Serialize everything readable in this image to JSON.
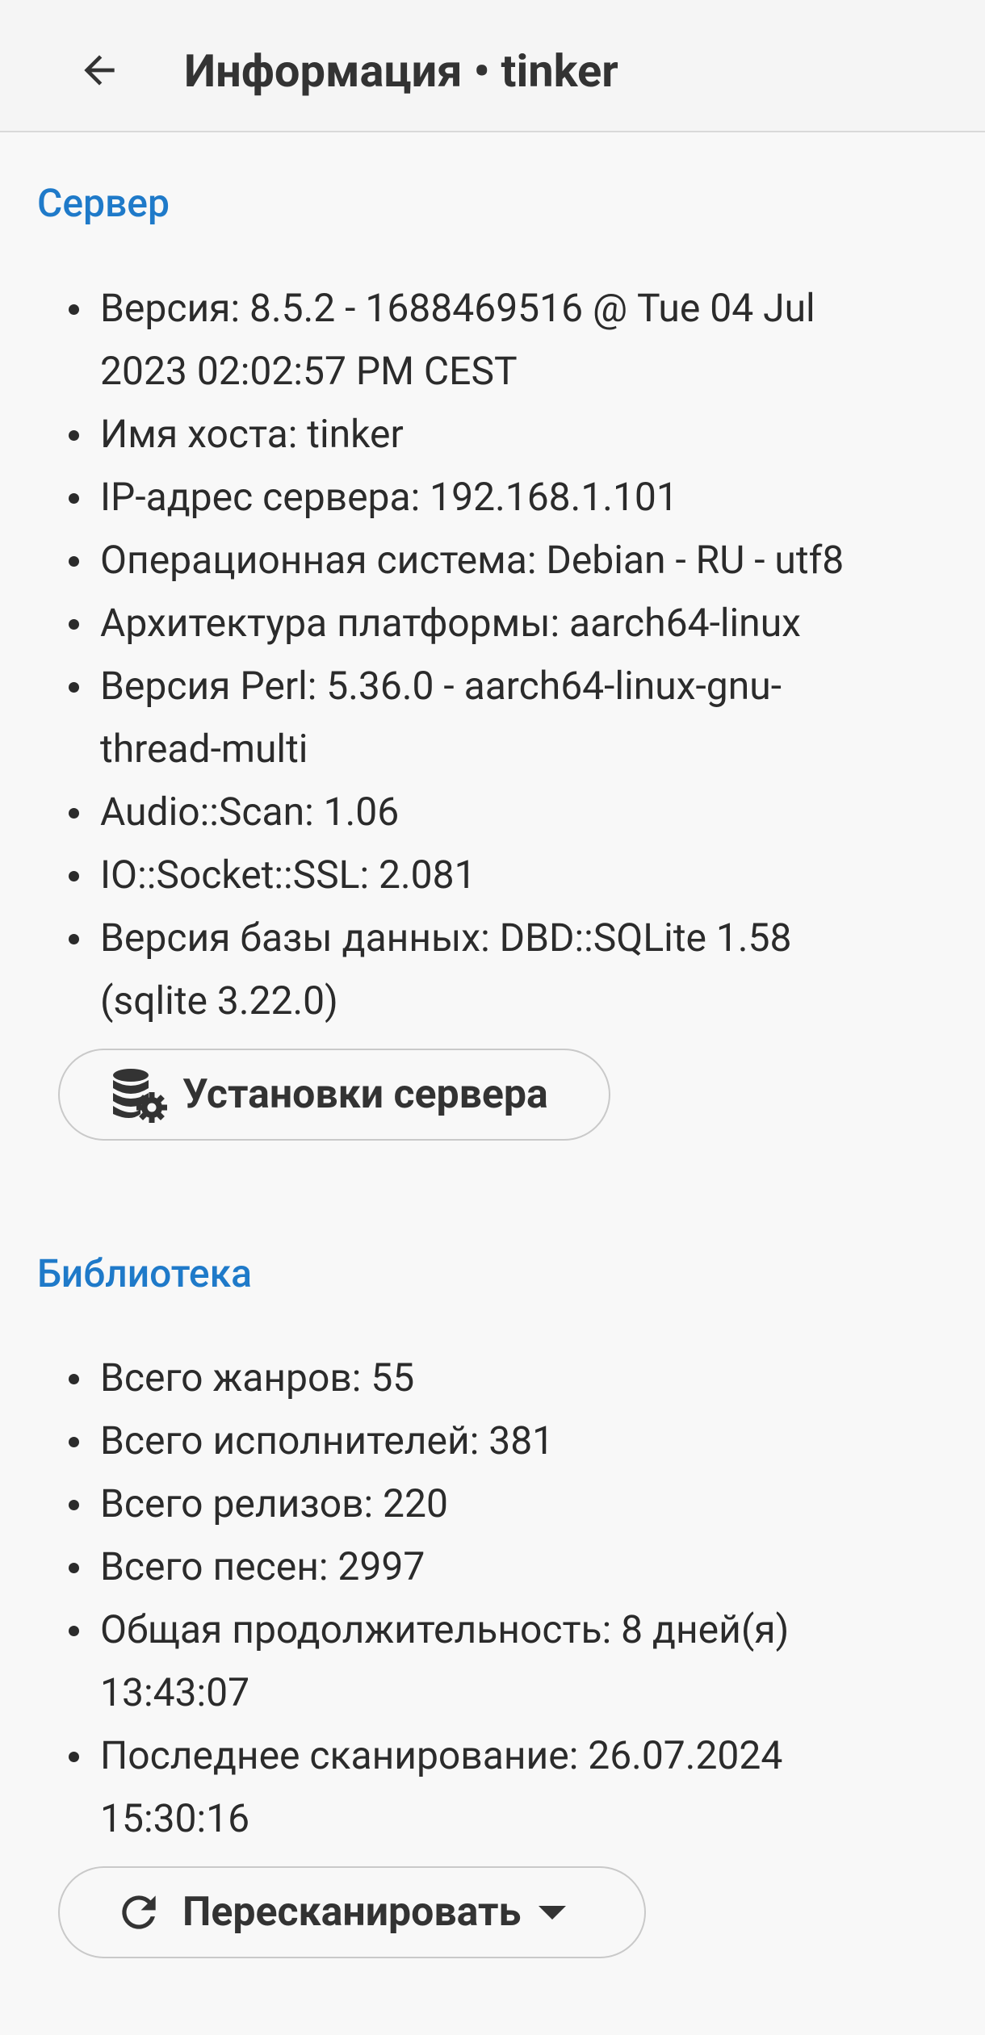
{
  "appbar": {
    "title": "Информация • tinker"
  },
  "server": {
    "section_title": "Сервер",
    "items": [
      "Версия: 8.5.2 - 1688469516 @ Tue 04 Jul 2023 02:02:57 PM CEST",
      "Имя хоста: tinker",
      "IP-адрес сервера: 192.168.1.101",
      "Операционная система: Debian - RU - utf8",
      "Архитектура платформы: aarch64-linux",
      "Версия Perl: 5.36.0 - aarch64-linux-gnu-thread-multi",
      "Audio::Scan: 1.06",
      "IO::Socket::SSL: 2.081",
      "Версия базы данных: DBD::SQLite 1.58 (sqlite 3.22.0)"
    ],
    "settings_button": "Установки сервера",
    "settings_icon": "database-gear-icon"
  },
  "library": {
    "section_title": "Библиотека",
    "items": [
      "Всего жанров: 55",
      "Всего исполнителей: 381",
      "Всего релизов: 220",
      "Всего песен: 2997",
      "Общая продолжительность: 8 дней(я) 13:43:07",
      "Последнее сканирование: 26.07.2024 15:30:16"
    ],
    "rescan_button": "Пересканировать",
    "rescan_icon": "refresh-icon"
  }
}
